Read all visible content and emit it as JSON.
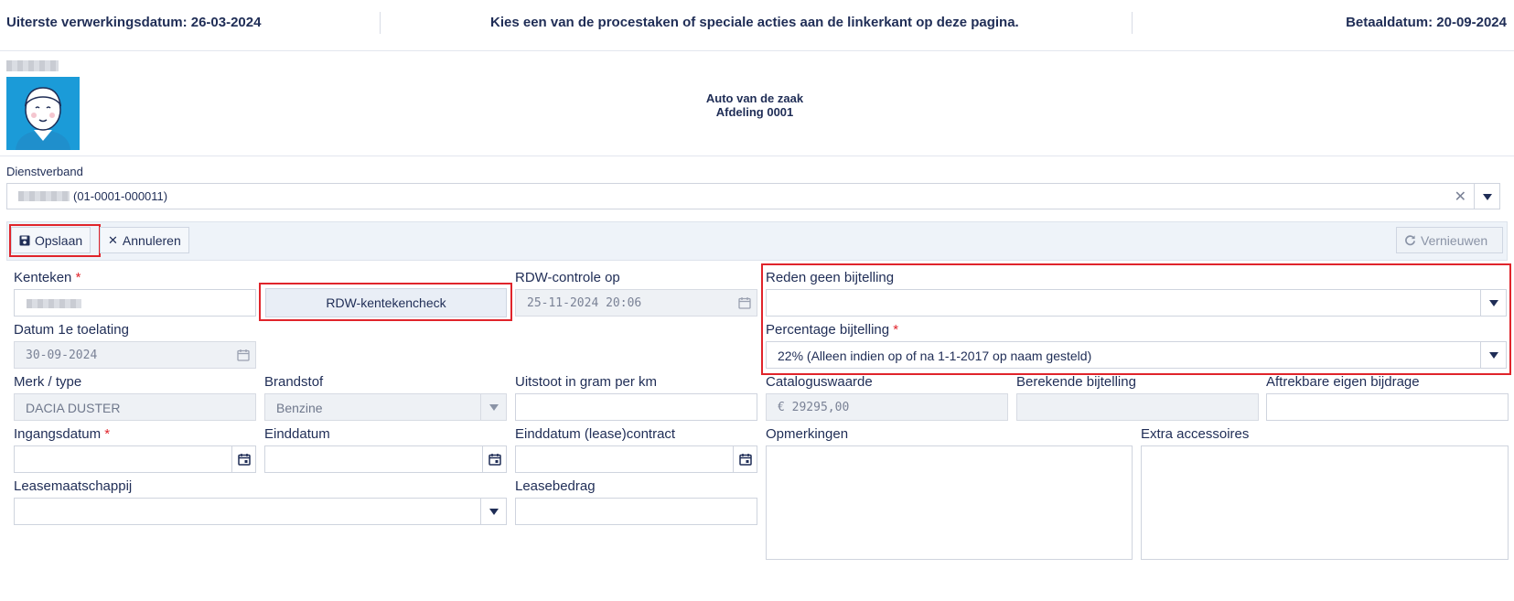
{
  "topbar": {
    "deadline": "Uiterste verwerkingsdatum: 26-03-2024",
    "instruction": "Kies een van de procestaken of speciale acties aan de linkerkant op deze pagina.",
    "paydate": "Betaaldatum: 20-09-2024"
  },
  "header": {
    "title": "Auto van de zaak",
    "department": "Afdeling 0001"
  },
  "dienstverband": {
    "label": "Dienstverband",
    "value": "(01-0001-000011)",
    "clear_icon": "close-icon",
    "arrow_icon": "chevron-down-icon"
  },
  "toolbar": {
    "save_label": "Opslaan",
    "save_icon": "floppy-disk-icon",
    "cancel_label": "Annuleren",
    "cancel_icon": "close-icon",
    "refresh_label": "Vernieuwen",
    "refresh_icon": "refresh-icon"
  },
  "form": {
    "kenteken": {
      "label": "Kenteken",
      "required": "*"
    },
    "rdw_button": "RDW-kentekencheck",
    "rdw_controle": {
      "label": "RDW-controle op",
      "value": "25-11-2024 20:06"
    },
    "reden_geen_bijtelling": {
      "label": "Reden geen bijtelling",
      "value": ""
    },
    "datum_toelating": {
      "label": "Datum 1e toelating",
      "value": "30-09-2024"
    },
    "percentage_bijtelling": {
      "label": "Percentage bijtelling",
      "required": "*",
      "value": "22% (Alleen indien op of na 1-1-2017 op naam gesteld)"
    },
    "merk_type": {
      "label": "Merk / type",
      "value": "DACIA DUSTER"
    },
    "brandstof": {
      "label": "Brandstof",
      "value": "Benzine"
    },
    "uitstoot": {
      "label": "Uitstoot in gram per km",
      "value": ""
    },
    "cataloguswaarde": {
      "label": "Cataloguswaarde",
      "value": "€ 29295,00"
    },
    "berekende_bijtelling": {
      "label": "Berekende bijtelling",
      "value": ""
    },
    "aftrekbare_bijdrage": {
      "label": "Aftrekbare eigen bijdrage",
      "value": ""
    },
    "ingangsdatum": {
      "label": "Ingangsdatum",
      "required": "*",
      "value": ""
    },
    "einddatum": {
      "label": "Einddatum",
      "value": ""
    },
    "einddatum_contract": {
      "label": "Einddatum (lease)contract",
      "value": ""
    },
    "opmerkingen": {
      "label": "Opmerkingen",
      "value": ""
    },
    "extra_accessoires": {
      "label": "Extra accessoires",
      "value": ""
    },
    "leasemaatschappij": {
      "label": "Leasemaatschappij",
      "value": ""
    },
    "leasebedrag": {
      "label": "Leasebedrag",
      "value": ""
    }
  },
  "colors": {
    "accent": "#1f2d56",
    "highlight": "#e0242b",
    "avatar_bg": "#1b9bd8",
    "toolbar_bg": "#eef3f9"
  }
}
